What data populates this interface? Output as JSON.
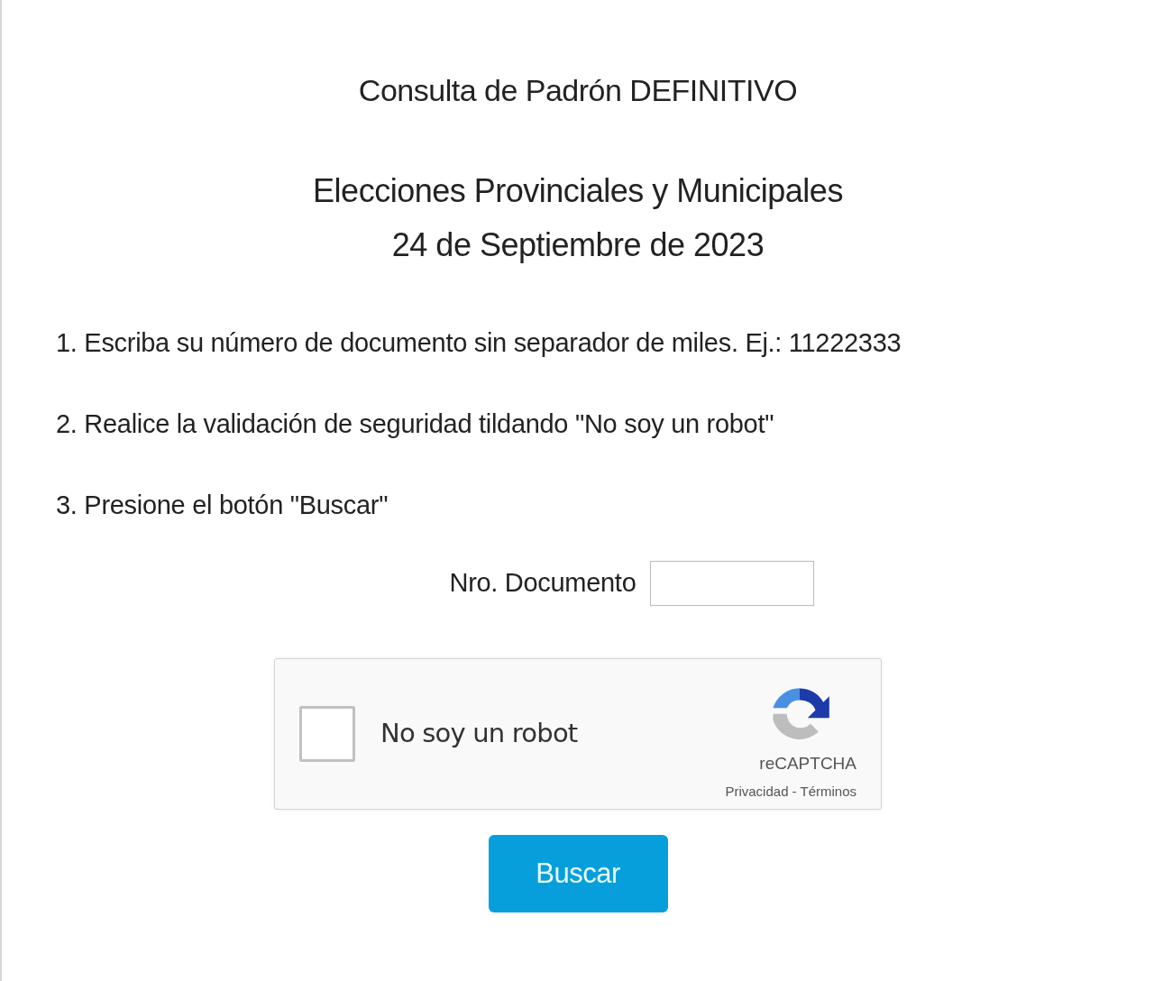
{
  "title": "Consulta de Padrón DEFINITIVO",
  "subtitle_lines": [
    "Elecciones Provinciales y Municipales",
    "24 de Septiembre de 2023"
  ],
  "steps": [
    "1. Escriba su número de documento sin separador de miles. Ej.: 11222333",
    "2. Realice la validación de seguridad tildando \"No soy un robot\"",
    "3. Presione el botón \"Buscar\""
  ],
  "document_field": {
    "label": "Nro. Documento"
  },
  "captcha": {
    "label": "No soy un robot",
    "checked": false,
    "brand": "reCAPTCHA",
    "privacy": "Privacidad",
    "separator": "-",
    "terms": "Términos"
  },
  "button": "Buscar"
}
